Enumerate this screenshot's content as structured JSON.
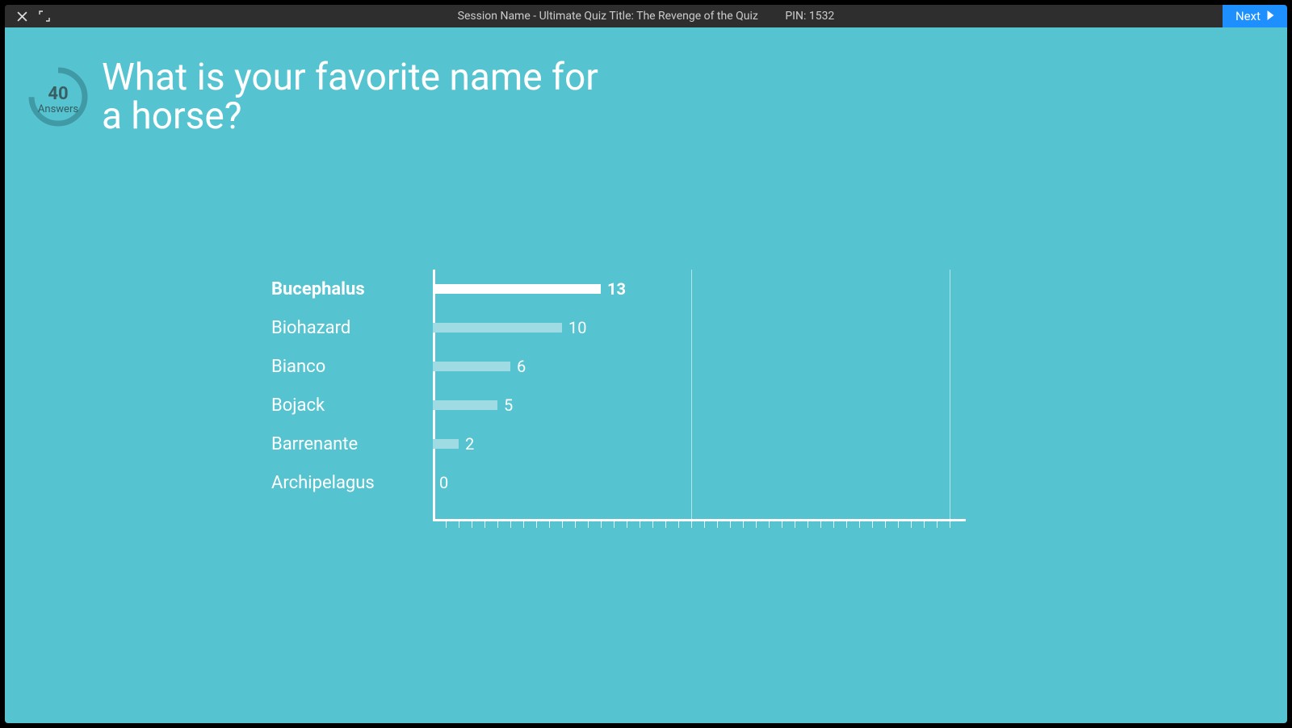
{
  "titlebar": {
    "session": "Session Name",
    "separator": "  -  ",
    "quiz_title": "Ultimate Quiz Title: The Revenge of the Quiz",
    "pin_label": "PIN:",
    "pin_value": "1532",
    "next_label": "Next"
  },
  "answers": {
    "count": "40",
    "label": "Answers",
    "percent": 75
  },
  "question": "What is your favorite name for a horse?",
  "chart_data": {
    "type": "bar",
    "orientation": "horizontal",
    "categories": [
      "Bucephalus",
      "Biohazard",
      "Bianco",
      "Bojack",
      "Barrenante",
      "Archipelagus"
    ],
    "values": [
      13,
      10,
      6,
      5,
      2,
      0
    ],
    "correct_index": 0,
    "title": "",
    "xlabel": "",
    "ylabel": "",
    "xlim": [
      0,
      40
    ],
    "major_gridlines": [
      20,
      40
    ],
    "minor_tick_interval": 1
  },
  "colors": {
    "background": "#56c4d0",
    "bar_default": "#9fdbe3",
    "bar_correct": "#ffffff",
    "titlebar": "#2e2e2e",
    "next_button": "#1d8fff"
  }
}
